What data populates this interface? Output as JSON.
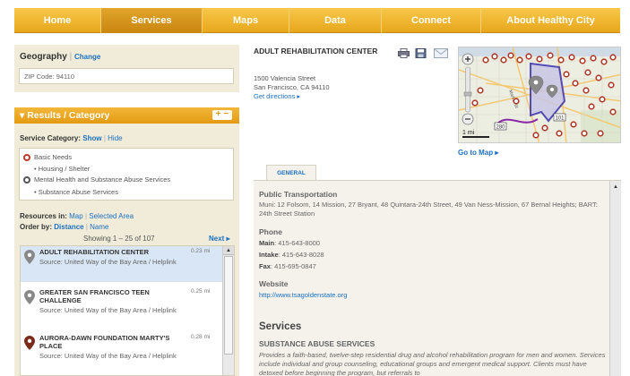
{
  "nav": {
    "tabs": [
      {
        "label": "Home"
      },
      {
        "label": "Services"
      },
      {
        "label": "Maps"
      },
      {
        "label": "Data"
      },
      {
        "label": "Connect"
      },
      {
        "label": "About Healthy City"
      }
    ],
    "active": "Services"
  },
  "geography": {
    "title": "Geography",
    "sep": "|",
    "change": "Change",
    "zip": "ZIP Code: 94110"
  },
  "results": {
    "title": "▾ Results / Category",
    "plus_minus": "+ −",
    "service_category_label": "Service Category:",
    "show": "Show",
    "sep": "|",
    "hide": "Hide",
    "categories": [
      {
        "label": "Basic Needs",
        "color": "#c0392b"
      },
      {
        "label": "Housing / Shelter",
        "sub": true
      },
      {
        "label": "Mental Health and Substance Abuse Services",
        "color": "#555555"
      },
      {
        "label": "Substance Abuse Services",
        "sub": true
      }
    ],
    "resources_in_label": "Resources in:",
    "map": "Map",
    "selected_area": "Selected Area",
    "order_by_label": "Order by:",
    "distance": "Distance",
    "name": "Name",
    "showing": "Showing 1 – 25 of 107",
    "next": "Next ▸",
    "items": [
      {
        "name": "ADULT REHABILITATION CENTER",
        "source": "Source: United Way of the Bay Area / Helplink",
        "dist": "0.23 mi",
        "pin_color": "#888888"
      },
      {
        "name": "GREATER SAN FRANCISCO TEEN CHALLENGE",
        "source": "Source: United Way of the Bay Area / Helplink",
        "dist": "0.25 mi",
        "pin_color": "#888888"
      },
      {
        "name": "AURORA-DAWN FOUNDATION MARTY'S PLACE",
        "source": "Source: United Way of the Bay Area / Helplink",
        "dist": "0.28 mi",
        "pin_color": "#7a2a1a"
      }
    ]
  },
  "place": {
    "name": "ADULT REHABILITATION CENTER",
    "address_line1": "1500 Valencia Street",
    "address_line2": "San Francisco, CA 94110",
    "directions": "Get directions ▸",
    "tools": [
      "print-icon",
      "save-icon",
      "email-icon"
    ]
  },
  "map": {
    "scale": "1 mi",
    "goto": "Go to Map ▸",
    "labels": [
      "101",
      "280",
      "Market St"
    ]
  },
  "detail": {
    "tab": "GENERAL",
    "public_transportation_h": "Public Transportation",
    "public_transportation": "Muni: 12 Folsom, 14 Mission, 27 Bryant, 48 Quintara-24th Street, 49 Van Ness-Mission, 67 Bernal Heights; BART: 24th Street Station",
    "phone_h": "Phone",
    "main_label": "Main",
    "main": ": 415-643-8000",
    "intake_label": "Intake",
    "intake": ": 415-643-8028",
    "fax_label": "Fax",
    "fax": ": 415-695-0847",
    "website_h": "Website",
    "website": "http://www.tsagoldenstate.org",
    "services_h": "Services",
    "substance_h": "SUBSTANCE ABUSE SERVICES",
    "substance_text": "Provides a faith-based, twelve-step residential drug and alcohol rehabilitation program for men and women. Services include individual and group counseling, educational groups and emergent medical support. Clients must have detoxed before beginning the program, but referrals to"
  }
}
